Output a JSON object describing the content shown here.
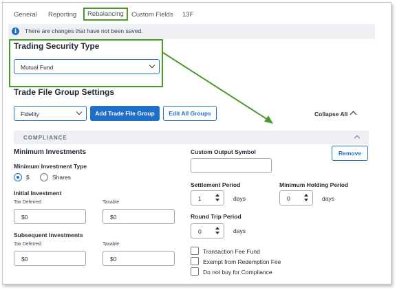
{
  "tabs": [
    "General",
    "Reporting",
    "Rebalancing",
    "Custom Fields",
    "13F"
  ],
  "active_tab": "Rebalancing",
  "banner": {
    "message": "There are changes that have not been saved.",
    "icon": "info-icon"
  },
  "trading_security_type": {
    "title": "Trading Security Type",
    "selected": "Mutual Fund"
  },
  "trade_file_group": {
    "title": "Trade File Group Settings",
    "selected": "Fidelity",
    "add_label": "Add Trade File Group",
    "edit_label": "Edit All Groups",
    "collapse_label": "Collapse All"
  },
  "compliance": {
    "header": "COMPLIANCE",
    "min_investments_title": "Minimum Investments",
    "min_investment_type_label": "Minimum Investment Type",
    "radio_dollar": "$",
    "radio_shares": "Shares",
    "initial_investment_label": "Initial Investment",
    "subsequent_investments_label": "Subsequent Investments",
    "tax_deferred_label": "Tax Deferred",
    "taxable_label": "Taxable",
    "initial_tax_deferred": "$0",
    "initial_taxable": "$0",
    "subsequent_tax_deferred": "$0",
    "subsequent_taxable": "$0",
    "custom_output_symbol_label": "Custom Output Symbol",
    "custom_output_symbol_value": "",
    "remove_label": "Remove",
    "settlement_period_label": "Settlement Period",
    "settlement_period_value": "1",
    "min_holding_period_label": "Minimum Holding Period",
    "min_holding_period_value": "0",
    "round_trip_period_label": "Round Trip Period",
    "round_trip_period_value": "0",
    "days_label": "days",
    "checkboxes": [
      "Transaction Fee Fund",
      "Exempt from Redemption Fee",
      "Do not buy for Compliance"
    ]
  },
  "colors": {
    "accent": "#1e6fc8",
    "highlight": "#4a9a2b"
  }
}
